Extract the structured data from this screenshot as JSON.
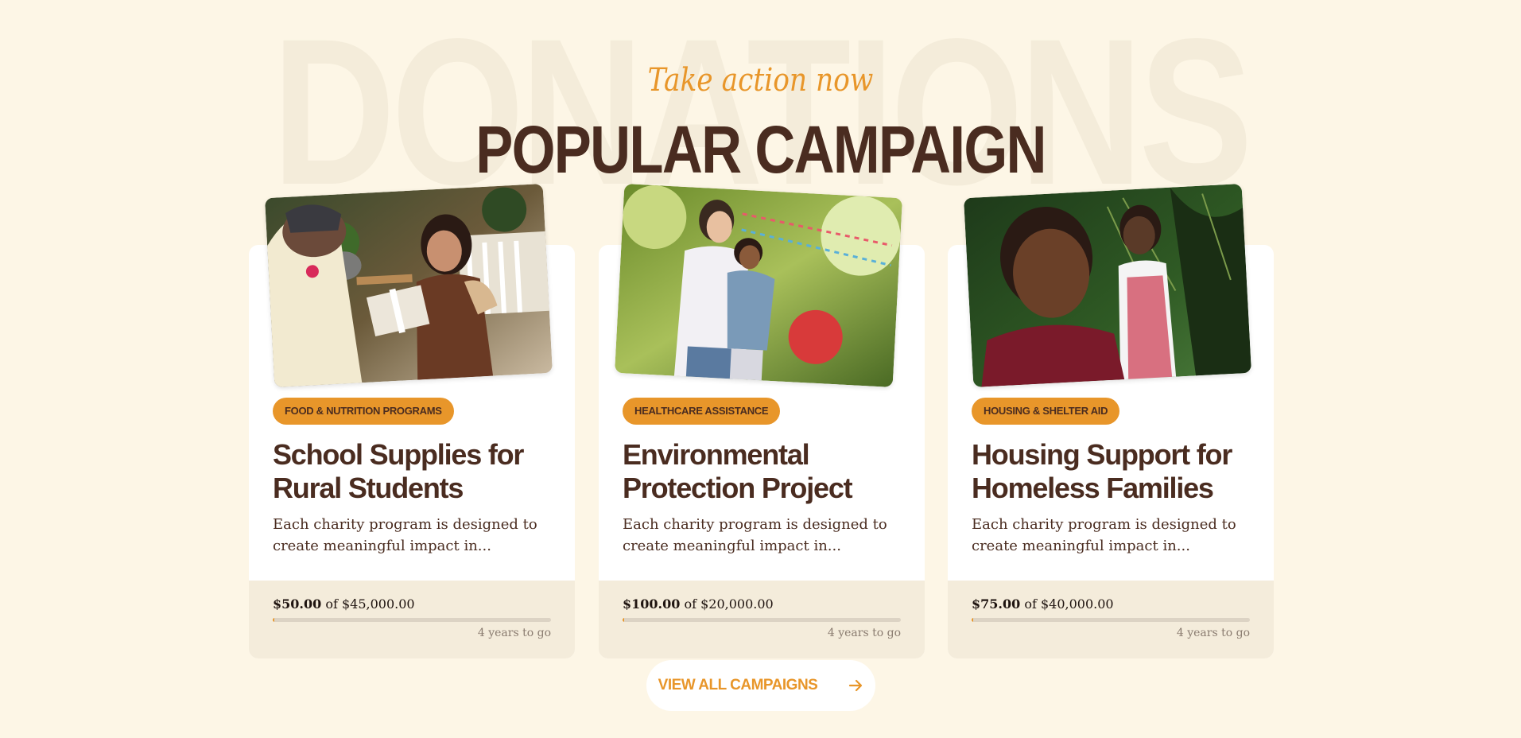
{
  "section": {
    "background_word": "DONATIONS",
    "eyebrow": "Take action now",
    "title": "POPULAR CAMPAIGN"
  },
  "campaigns": [
    {
      "category": "FOOD & NUTRITION PROGRAMS",
      "title": "School Supplies for Rural Students",
      "description": "Each charity program is designed to create meaningful impact in...",
      "raised": "$50.00",
      "of_label": "of",
      "goal": "$45,000.00",
      "progress_fraction": 0.0011,
      "remaining": "4 years to go",
      "image": "woman-and-girl-exchanging-gift-box"
    },
    {
      "category": "HEALTHCARE ASSISTANCE",
      "title": "Environmental Protection Project",
      "description": "Each charity program is designed to create meaningful impact in...",
      "raised": "$100.00",
      "of_label": "of",
      "goal": "$20,000.00",
      "progress_fraction": 0.005,
      "remaining": "4 years to go",
      "image": "woman-hugging-child-outdoors"
    },
    {
      "category": "HOUSING & SHELTER AID",
      "title": "Housing Support for Homeless Families",
      "description": "Each charity program is designed to create meaningful impact in...",
      "raised": "$75.00",
      "of_label": "of",
      "goal": "$40,000.00",
      "progress_fraction": 0.0019,
      "remaining": "4 years to go",
      "image": "two-children-among-greenery"
    }
  ],
  "cta": {
    "label": "VIEW ALL CAMPAIGNS",
    "icon": "arrow-right-icon"
  },
  "colors": {
    "page_bg": "#fdf6e6",
    "accent": "#e8962a",
    "heading": "#4a2c20",
    "card_footer": "#f4ecdb"
  }
}
